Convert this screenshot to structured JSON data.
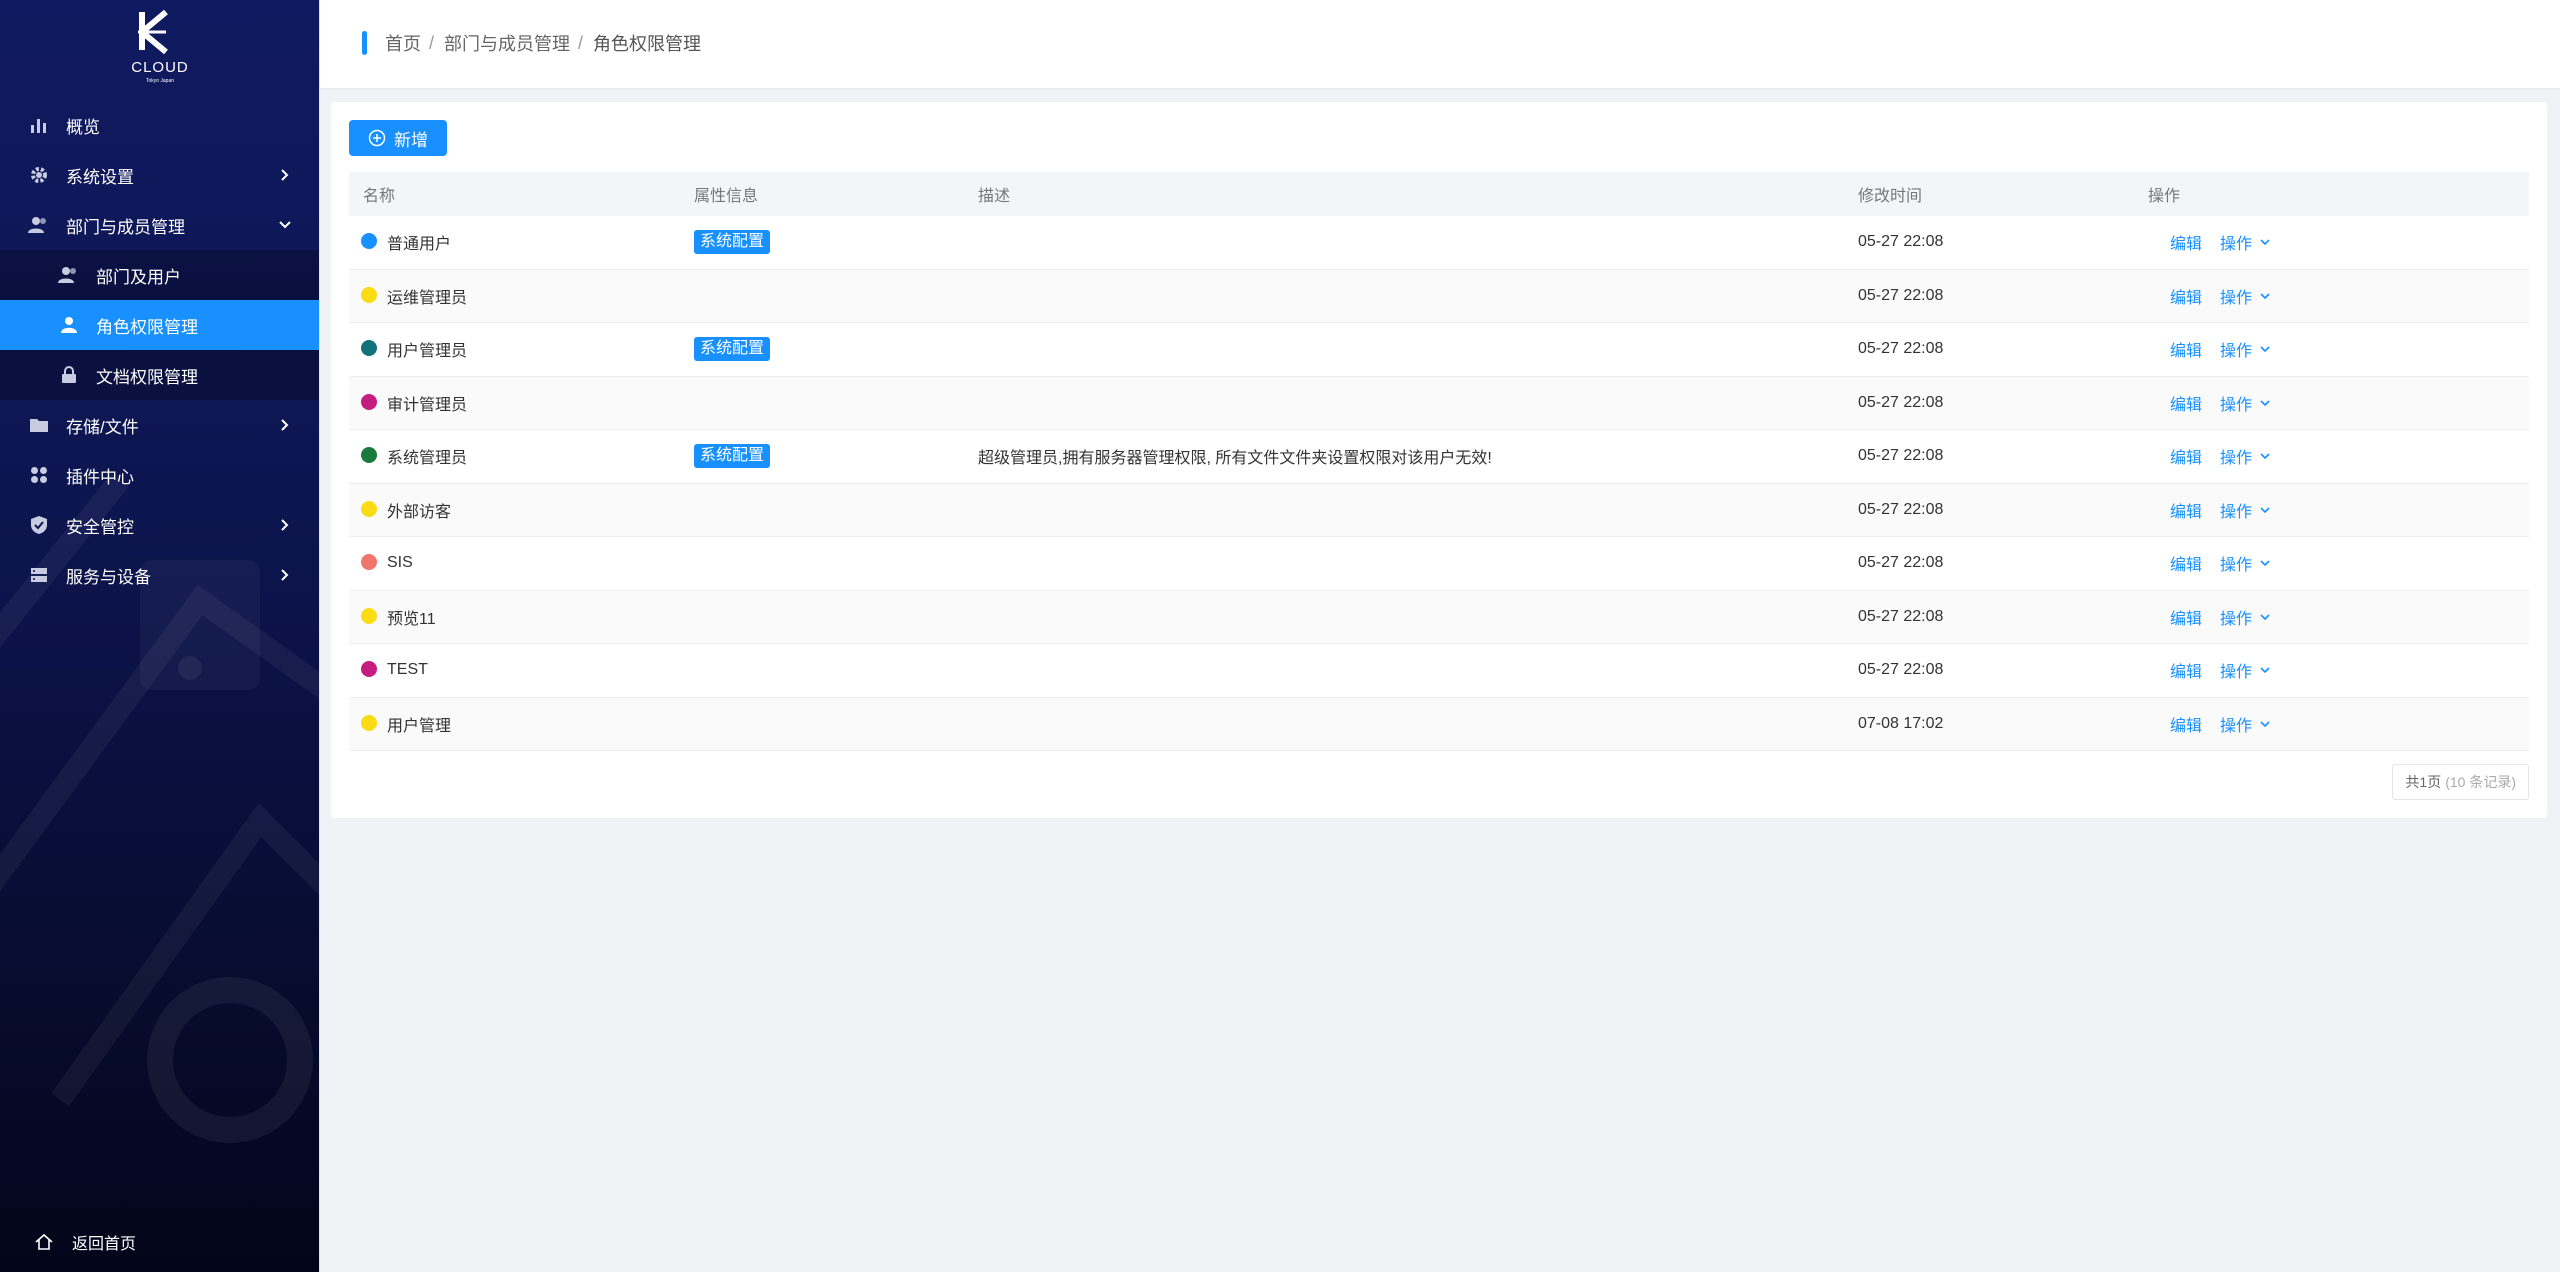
{
  "logo": {
    "text": "CLOUD",
    "subtext": "Tokyo Japan"
  },
  "sidebar": {
    "items": [
      {
        "label": "概览",
        "icon": "bar-chart-icon"
      },
      {
        "label": "系统设置",
        "icon": "gear-icon"
      },
      {
        "label": "部门与成员管理",
        "icon": "users-icon"
      },
      {
        "label": "部门及用户",
        "icon": "users-icon"
      },
      {
        "label": "角色权限管理",
        "icon": "user-icon"
      },
      {
        "label": "文档权限管理",
        "icon": "lock-icon"
      },
      {
        "label": "存储/文件",
        "icon": "folder-icon"
      },
      {
        "label": "插件中心",
        "icon": "grid-icon"
      },
      {
        "label": "安全管控",
        "icon": "shield-icon"
      },
      {
        "label": "服务与设备",
        "icon": "server-icon"
      }
    ],
    "back_home": "返回首页"
  },
  "breadcrumb": {
    "home": "首页",
    "section": "部门与成员管理",
    "current": "角色权限管理",
    "separator": "/"
  },
  "toolbar": {
    "add_label": "新增"
  },
  "table": {
    "headers": {
      "name": "名称",
      "attr": "属性信息",
      "desc": "描述",
      "time": "修改时间",
      "ops": "操作"
    },
    "edit_label": "编辑",
    "ops_label": "操作",
    "rows": [
      {
        "name": "普通用户",
        "color": "#1890ff",
        "tag": "系统配置",
        "desc": "",
        "time": "05-27 22:08"
      },
      {
        "name": "运维管理员",
        "color": "#fadb14",
        "tag": "",
        "desc": "",
        "time": "05-27 22:08"
      },
      {
        "name": "用户管理员",
        "color": "#13717a",
        "tag": "系统配置",
        "desc": "",
        "time": "05-27 22:08"
      },
      {
        "name": "审计管理员",
        "color": "#c41d7f",
        "tag": "",
        "desc": "",
        "time": "05-27 22:08"
      },
      {
        "name": "系统管理员",
        "color": "#1a7a3e",
        "tag": "系统配置",
        "desc": "超级管理员,拥有服务器管理权限, 所有文件文件夹设置权限对该用户无效!",
        "time": "05-27 22:08"
      },
      {
        "name": "外部访客",
        "color": "#fadb14",
        "tag": "",
        "desc": "",
        "time": "05-27 22:08"
      },
      {
        "name": "SIS",
        "color": "#f0756b",
        "tag": "",
        "desc": "",
        "time": "05-27 22:08"
      },
      {
        "name": "预览11",
        "color": "#fadb14",
        "tag": "",
        "desc": "",
        "time": "05-27 22:08"
      },
      {
        "name": "TEST",
        "color": "#c41d7f",
        "tag": "",
        "desc": "",
        "time": "05-27 22:08"
      },
      {
        "name": "用户管理",
        "color": "#fadb14",
        "tag": "",
        "desc": "",
        "time": "07-08 17:02"
      }
    ]
  },
  "pager": {
    "total": "共1页",
    "records": "(10 条记录)"
  }
}
